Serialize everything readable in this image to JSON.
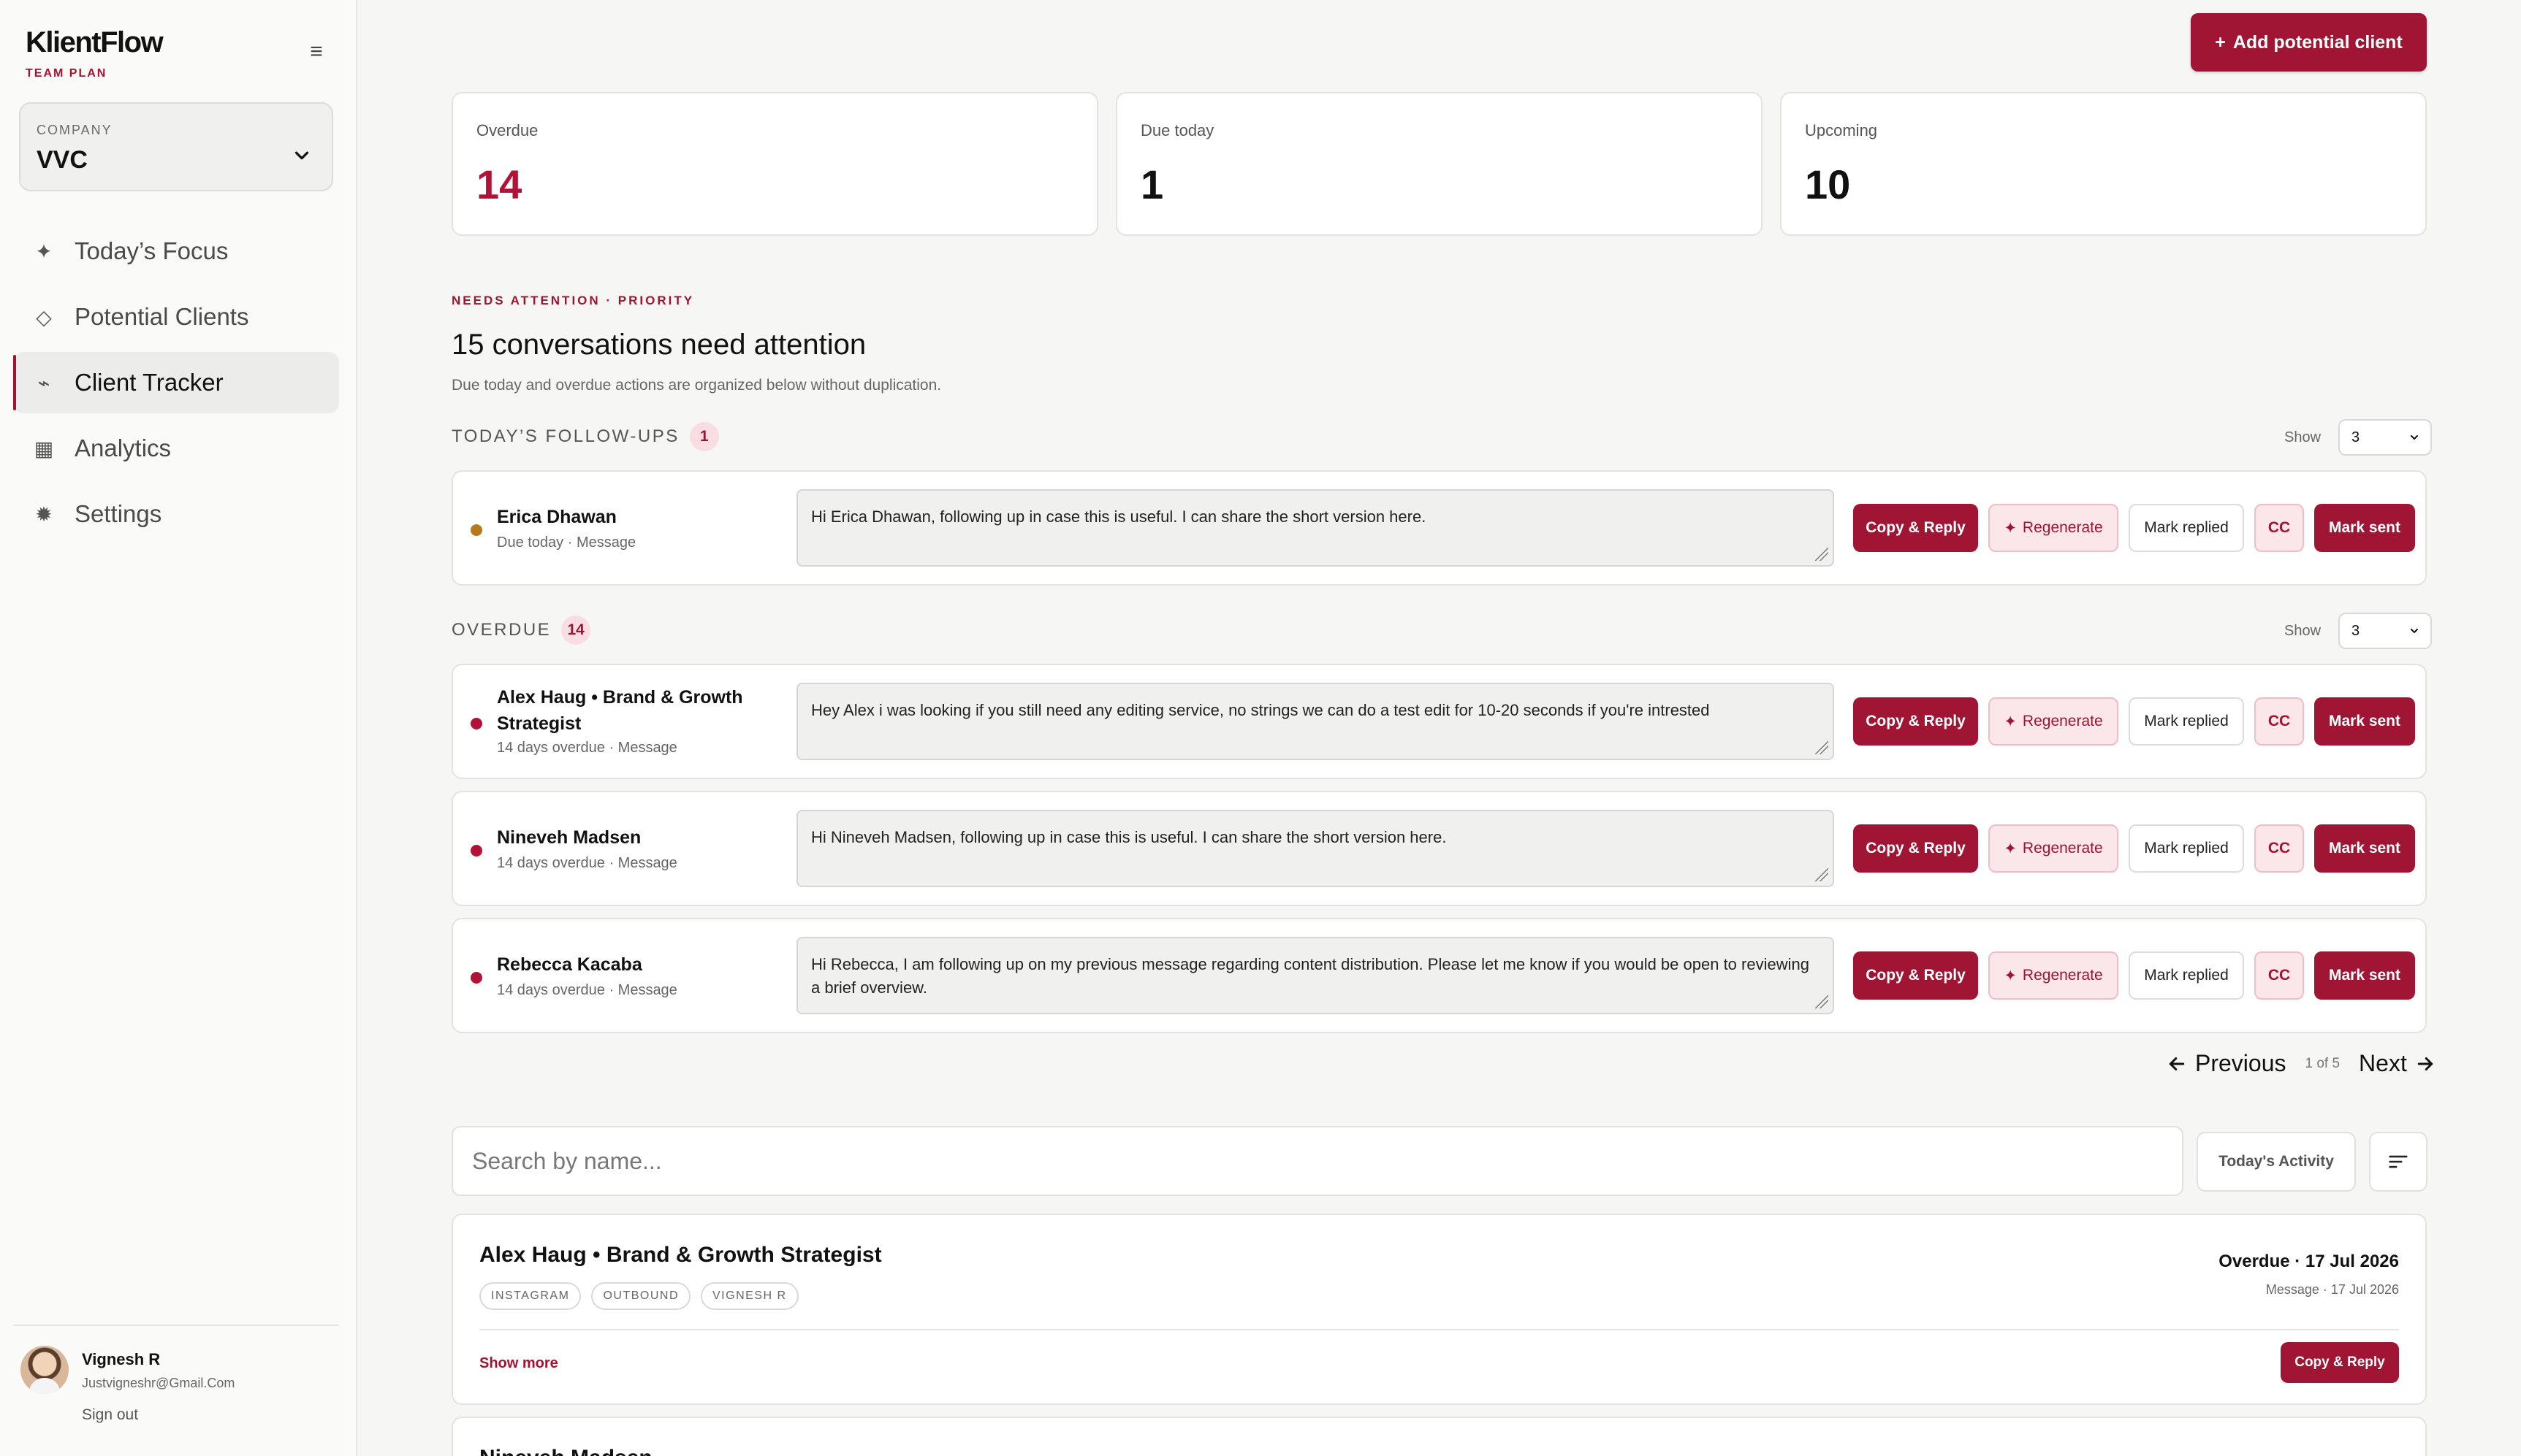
{
  "app": {
    "name": "KlientFlow",
    "plan": "TEAM PLAN"
  },
  "company": {
    "label": "COMPANY",
    "value": "VVC"
  },
  "nav": [
    {
      "icon": "sparkle-icon",
      "glyph": "✦",
      "label": "Today’s Focus",
      "active": false
    },
    {
      "icon": "diamond-icon",
      "glyph": "◇",
      "label": "Potential Clients",
      "active": false
    },
    {
      "icon": "trend-icon",
      "glyph": "⌁",
      "label": "Client Tracker",
      "active": true
    },
    {
      "icon": "grid-icon",
      "glyph": "▦",
      "label": "Analytics",
      "active": false
    },
    {
      "icon": "gear-icon",
      "glyph": "✹",
      "label": "Settings",
      "active": false
    }
  ],
  "user": {
    "name": "Vignesh R",
    "email": "Justvigneshr@Gmail.Com",
    "signout": "Sign out"
  },
  "header": {
    "add_button": "Add potential client"
  },
  "stats": [
    {
      "label": "Overdue",
      "value": "14",
      "color": "#b11235"
    },
    {
      "label": "Due today",
      "value": "1"
    },
    {
      "label": "Upcoming",
      "value": "10"
    }
  ],
  "attention": {
    "eyebrow": "NEEDS ATTENTION · PRIORITY",
    "title": "15 conversations need attention",
    "subtitle": "Due today and overdue actions are organized below without duplication."
  },
  "sections": {
    "today": {
      "title": "TODAY’S FOLLOW-UPS",
      "count": "1",
      "show_label": "Show",
      "show_value": "3"
    },
    "overdue": {
      "title": "OVERDUE",
      "count": "14",
      "show_label": "Show",
      "show_value": "3"
    }
  },
  "actions": {
    "copy_reply": "Copy & Reply",
    "regenerate": "Regenerate",
    "mark_replied": "Mark replied",
    "cc": "CC",
    "mark_sent": "Mark sent"
  },
  "today_items": [
    {
      "name": "Erica Dhawan",
      "meta": "Due today · Message",
      "message": "Hi Erica Dhawan, following up in case this is useful. I can share the short version here.",
      "status_color": "#b57a1a"
    }
  ],
  "overdue_items": [
    {
      "name": "Alex Haug • Brand & Growth Strategist",
      "meta": "14 days overdue · Message",
      "message": "Hey Alex i was looking if you still need any editing service, no strings we can do a test edit for 10-20 seconds if you're intrested"
    },
    {
      "name": "Nineveh Madsen",
      "meta": "14 days overdue · Message",
      "message": "Hi Nineveh Madsen, following up in case this is useful. I can share the short version here."
    },
    {
      "name": "Rebecca Kacaba",
      "meta": "14 days overdue · Message",
      "message": "Hi Rebecca, I am following up on my previous message regarding content distribution. Please let me know if you would be open to reviewing a brief overview."
    }
  ],
  "pagination": {
    "previous": "Previous",
    "info": "1 of 5",
    "next": "Next"
  },
  "search": {
    "placeholder": "Search by name...",
    "activity_button": "Today's Activity"
  },
  "client_list": [
    {
      "name": "Alex Haug • Brand & Growth Strategist",
      "tags": [
        "INSTAGRAM",
        "OUTBOUND",
        "VIGNESH R"
      ],
      "status": "Overdue · 17 Jul 2026",
      "sub": "Message · 17 Jul 2026",
      "show_more": "Show more",
      "copy_reply": "Copy & Reply"
    },
    {
      "name": "Nineveh Madsen"
    }
  ]
}
